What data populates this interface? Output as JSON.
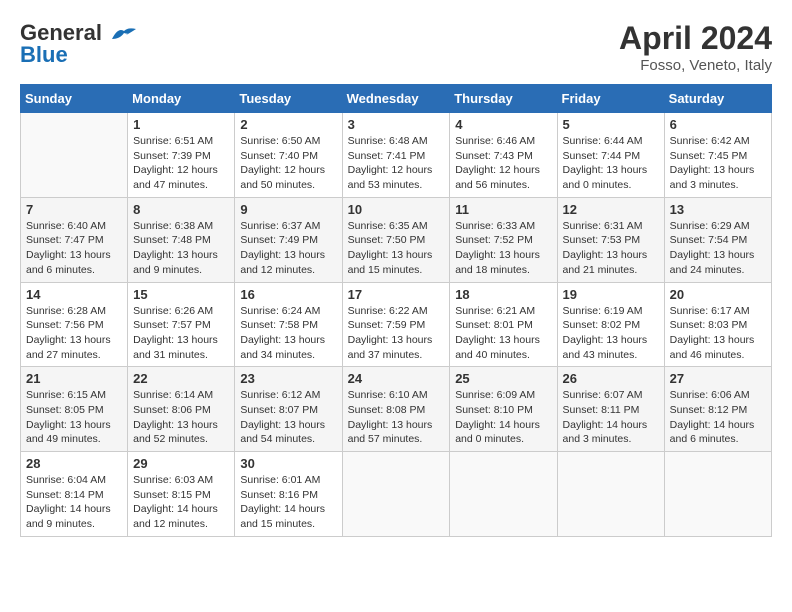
{
  "header": {
    "logo_line1": "General",
    "logo_line2": "Blue",
    "month_title": "April 2024",
    "location": "Fosso, Veneto, Italy"
  },
  "weekdays": [
    "Sunday",
    "Monday",
    "Tuesday",
    "Wednesday",
    "Thursday",
    "Friday",
    "Saturday"
  ],
  "weeks": [
    [
      {
        "day": "",
        "sunrise": "",
        "sunset": "",
        "daylight": ""
      },
      {
        "day": "1",
        "sunrise": "Sunrise: 6:51 AM",
        "sunset": "Sunset: 7:39 PM",
        "daylight": "Daylight: 12 hours and 47 minutes."
      },
      {
        "day": "2",
        "sunrise": "Sunrise: 6:50 AM",
        "sunset": "Sunset: 7:40 PM",
        "daylight": "Daylight: 12 hours and 50 minutes."
      },
      {
        "day": "3",
        "sunrise": "Sunrise: 6:48 AM",
        "sunset": "Sunset: 7:41 PM",
        "daylight": "Daylight: 12 hours and 53 minutes."
      },
      {
        "day": "4",
        "sunrise": "Sunrise: 6:46 AM",
        "sunset": "Sunset: 7:43 PM",
        "daylight": "Daylight: 12 hours and 56 minutes."
      },
      {
        "day": "5",
        "sunrise": "Sunrise: 6:44 AM",
        "sunset": "Sunset: 7:44 PM",
        "daylight": "Daylight: 13 hours and 0 minutes."
      },
      {
        "day": "6",
        "sunrise": "Sunrise: 6:42 AM",
        "sunset": "Sunset: 7:45 PM",
        "daylight": "Daylight: 13 hours and 3 minutes."
      }
    ],
    [
      {
        "day": "7",
        "sunrise": "Sunrise: 6:40 AM",
        "sunset": "Sunset: 7:47 PM",
        "daylight": "Daylight: 13 hours and 6 minutes."
      },
      {
        "day": "8",
        "sunrise": "Sunrise: 6:38 AM",
        "sunset": "Sunset: 7:48 PM",
        "daylight": "Daylight: 13 hours and 9 minutes."
      },
      {
        "day": "9",
        "sunrise": "Sunrise: 6:37 AM",
        "sunset": "Sunset: 7:49 PM",
        "daylight": "Daylight: 13 hours and 12 minutes."
      },
      {
        "day": "10",
        "sunrise": "Sunrise: 6:35 AM",
        "sunset": "Sunset: 7:50 PM",
        "daylight": "Daylight: 13 hours and 15 minutes."
      },
      {
        "day": "11",
        "sunrise": "Sunrise: 6:33 AM",
        "sunset": "Sunset: 7:52 PM",
        "daylight": "Daylight: 13 hours and 18 minutes."
      },
      {
        "day": "12",
        "sunrise": "Sunrise: 6:31 AM",
        "sunset": "Sunset: 7:53 PM",
        "daylight": "Daylight: 13 hours and 21 minutes."
      },
      {
        "day": "13",
        "sunrise": "Sunrise: 6:29 AM",
        "sunset": "Sunset: 7:54 PM",
        "daylight": "Daylight: 13 hours and 24 minutes."
      }
    ],
    [
      {
        "day": "14",
        "sunrise": "Sunrise: 6:28 AM",
        "sunset": "Sunset: 7:56 PM",
        "daylight": "Daylight: 13 hours and 27 minutes."
      },
      {
        "day": "15",
        "sunrise": "Sunrise: 6:26 AM",
        "sunset": "Sunset: 7:57 PM",
        "daylight": "Daylight: 13 hours and 31 minutes."
      },
      {
        "day": "16",
        "sunrise": "Sunrise: 6:24 AM",
        "sunset": "Sunset: 7:58 PM",
        "daylight": "Daylight: 13 hours and 34 minutes."
      },
      {
        "day": "17",
        "sunrise": "Sunrise: 6:22 AM",
        "sunset": "Sunset: 7:59 PM",
        "daylight": "Daylight: 13 hours and 37 minutes."
      },
      {
        "day": "18",
        "sunrise": "Sunrise: 6:21 AM",
        "sunset": "Sunset: 8:01 PM",
        "daylight": "Daylight: 13 hours and 40 minutes."
      },
      {
        "day": "19",
        "sunrise": "Sunrise: 6:19 AM",
        "sunset": "Sunset: 8:02 PM",
        "daylight": "Daylight: 13 hours and 43 minutes."
      },
      {
        "day": "20",
        "sunrise": "Sunrise: 6:17 AM",
        "sunset": "Sunset: 8:03 PM",
        "daylight": "Daylight: 13 hours and 46 minutes."
      }
    ],
    [
      {
        "day": "21",
        "sunrise": "Sunrise: 6:15 AM",
        "sunset": "Sunset: 8:05 PM",
        "daylight": "Daylight: 13 hours and 49 minutes."
      },
      {
        "day": "22",
        "sunrise": "Sunrise: 6:14 AM",
        "sunset": "Sunset: 8:06 PM",
        "daylight": "Daylight: 13 hours and 52 minutes."
      },
      {
        "day": "23",
        "sunrise": "Sunrise: 6:12 AM",
        "sunset": "Sunset: 8:07 PM",
        "daylight": "Daylight: 13 hours and 54 minutes."
      },
      {
        "day": "24",
        "sunrise": "Sunrise: 6:10 AM",
        "sunset": "Sunset: 8:08 PM",
        "daylight": "Daylight: 13 hours and 57 minutes."
      },
      {
        "day": "25",
        "sunrise": "Sunrise: 6:09 AM",
        "sunset": "Sunset: 8:10 PM",
        "daylight": "Daylight: 14 hours and 0 minutes."
      },
      {
        "day": "26",
        "sunrise": "Sunrise: 6:07 AM",
        "sunset": "Sunset: 8:11 PM",
        "daylight": "Daylight: 14 hours and 3 minutes."
      },
      {
        "day": "27",
        "sunrise": "Sunrise: 6:06 AM",
        "sunset": "Sunset: 8:12 PM",
        "daylight": "Daylight: 14 hours and 6 minutes."
      }
    ],
    [
      {
        "day": "28",
        "sunrise": "Sunrise: 6:04 AM",
        "sunset": "Sunset: 8:14 PM",
        "daylight": "Daylight: 14 hours and 9 minutes."
      },
      {
        "day": "29",
        "sunrise": "Sunrise: 6:03 AM",
        "sunset": "Sunset: 8:15 PM",
        "daylight": "Daylight: 14 hours and 12 minutes."
      },
      {
        "day": "30",
        "sunrise": "Sunrise: 6:01 AM",
        "sunset": "Sunset: 8:16 PM",
        "daylight": "Daylight: 14 hours and 15 minutes."
      },
      {
        "day": "",
        "sunrise": "",
        "sunset": "",
        "daylight": ""
      },
      {
        "day": "",
        "sunrise": "",
        "sunset": "",
        "daylight": ""
      },
      {
        "day": "",
        "sunrise": "",
        "sunset": "",
        "daylight": ""
      },
      {
        "day": "",
        "sunrise": "",
        "sunset": "",
        "daylight": ""
      }
    ]
  ]
}
